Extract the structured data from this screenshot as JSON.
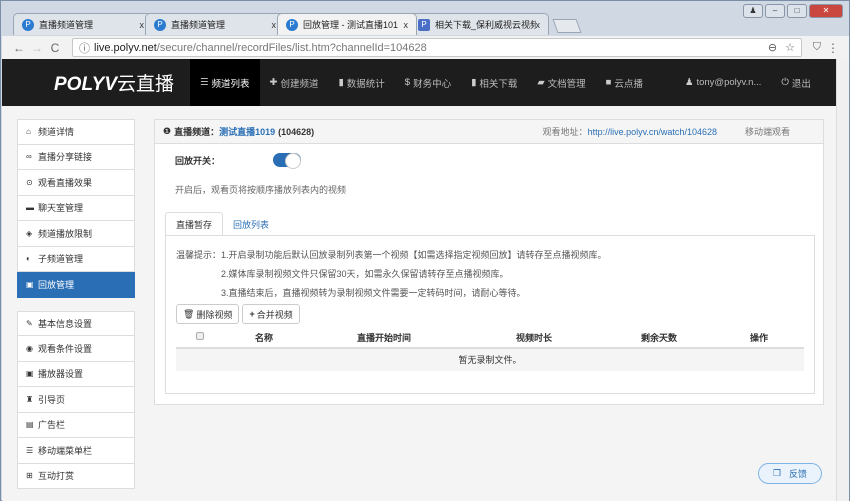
{
  "browser": {
    "tabs": [
      {
        "title": "直播频道管理",
        "icon": "P"
      },
      {
        "title": "直播频道管理",
        "icon": "P"
      },
      {
        "title": "回放管理 - 测试直播101",
        "icon": "P",
        "active": true
      },
      {
        "title": "相关下载_保利威视云视频",
        "icon": "P"
      }
    ],
    "url_host": "live.polyv.net",
    "url_path": "/secure/channel/recordFiles/list.htm?channelId=104628"
  },
  "navbar": {
    "logo": "POLYV",
    "logo_suffix": "云直播",
    "items": [
      {
        "label": "频道列表",
        "icon": "list-icon",
        "active": true
      },
      {
        "label": "创建频道",
        "icon": "plus-icon"
      },
      {
        "label": "数据统计",
        "icon": "bar-chart-icon"
      },
      {
        "label": "财务中心",
        "icon": "dollar-icon"
      },
      {
        "label": "相关下载",
        "icon": "bar-chart-icon"
      },
      {
        "label": "文档管理",
        "icon": "folder-icon"
      },
      {
        "label": "云点播",
        "icon": "video-icon"
      }
    ],
    "user": "tony@polyv.n...",
    "logout": "退出"
  },
  "sidebar": {
    "group1": [
      {
        "label": "频道详情",
        "icon": "home-icon"
      },
      {
        "label": "直播分享链接",
        "icon": "link-icon"
      },
      {
        "label": "观看直播效果",
        "icon": "play-circle-icon"
      },
      {
        "label": "聊天室管理",
        "icon": "comment-icon"
      },
      {
        "label": "频道播放限制",
        "icon": "eye-slash-icon"
      },
      {
        "label": "子频道管理",
        "icon": "adjust-icon"
      },
      {
        "label": "回放管理",
        "icon": "film-icon",
        "active": true
      }
    ],
    "group2": [
      {
        "label": "基本信息设置",
        "icon": "pencil-icon"
      },
      {
        "label": "观看条件设置",
        "icon": "eye-icon"
      },
      {
        "label": "播放器设置",
        "icon": "play-square-icon"
      },
      {
        "label": "引导页",
        "icon": "road-icon"
      },
      {
        "label": "广告栏",
        "icon": "briefcase-icon"
      },
      {
        "label": "移动端菜单栏",
        "icon": "menu-icon"
      },
      {
        "label": "互动打赏",
        "icon": "gift-icon"
      }
    ]
  },
  "panel": {
    "channel_label": "直播频道：",
    "channel_name": "测试直播1019",
    "channel_id": "(104628)",
    "watch_label": "观看地址：",
    "watch_url": "http://live.polyv.cn/watch/104628",
    "mobile": "移动端观看",
    "switch_label": "回放开关：",
    "switch_on": true,
    "hint": "开启后，观看页将按顺序播放列表内的视频",
    "tabs": [
      "直播暂存",
      "回放列表"
    ],
    "tips": [
      "温馨提示：1.开启录制功能后默认回放录制列表第一个视频【如需选择指定视频回放】请转存至点播视频库。",
      "2.媒体库录制视频文件只保留30天，如需永久保留请转存至点播视频库。",
      "3.直播结束后，直播视频转为录制视频文件需要一定转码时间，请耐心等待。"
    ],
    "delete_btn": "删除视频",
    "merge_btn": "合并视频",
    "columns": [
      "名称",
      "直播开始时间",
      "视频时长",
      "剩余天数",
      "操作"
    ],
    "empty": "暂无录制文件。"
  },
  "feedback": "反馈"
}
